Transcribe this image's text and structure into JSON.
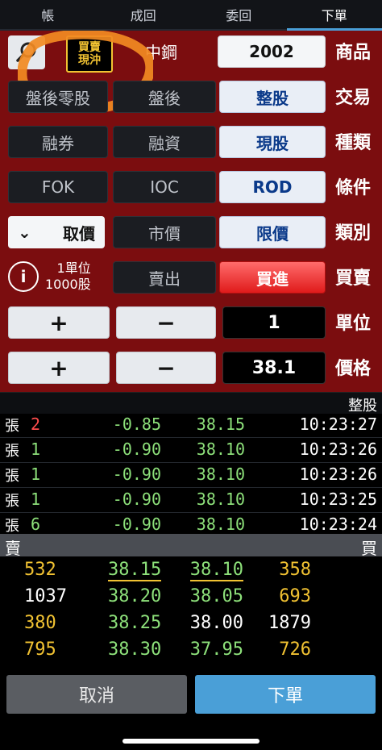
{
  "tabs": [
    {
      "label": "下單",
      "active": true
    },
    {
      "label": "委回"
    },
    {
      "label": "成回"
    },
    {
      "label": "帳"
    }
  ],
  "order": {
    "product_label": "商品",
    "stock_code": "2002",
    "stock_name": "中鋼",
    "quick_badge_top": "買賣",
    "quick_badge_bottom": "現沖",
    "trade_label": "交易",
    "trade_options": [
      "整股",
      "盤後",
      "盤後零股"
    ],
    "type_label": "種類",
    "type_options": [
      "現股",
      "融資",
      "融券"
    ],
    "cond_label": "條件",
    "cond_options": [
      "ROD",
      "IOC",
      "FOK"
    ],
    "category_label": "類別",
    "category_options": [
      "限價",
      "市價"
    ],
    "price_source": "取價",
    "side_label": "買賣",
    "side_options": [
      "買進",
      "賣出"
    ],
    "unit_info_top": "1單位",
    "unit_info_bottom": "1000股",
    "unit_label": "單位",
    "unit_value": "1",
    "price_label": "價格",
    "price_value": "38.1",
    "minus": "−",
    "plus": "+"
  },
  "trades": {
    "title": "整股",
    "unit": "張",
    "rows": [
      {
        "time": "10:23:27",
        "price": "38.15",
        "change": "-0.85",
        "vol": "2",
        "red": true
      },
      {
        "time": "10:23:26",
        "price": "38.10",
        "change": "-0.90",
        "vol": "1"
      },
      {
        "time": "10:23:26",
        "price": "38.10",
        "change": "-0.90",
        "vol": "1"
      },
      {
        "time": "10:23:25",
        "price": "38.10",
        "change": "-0.90",
        "vol": "1"
      },
      {
        "time": "10:23:24",
        "price": "38.10",
        "change": "-0.90",
        "vol": "6"
      }
    ]
  },
  "book": {
    "buy_label": "買",
    "sell_label": "賣",
    "rows": [
      {
        "buy_vol": "358",
        "buy_price": "38.10",
        "sell_price": "38.15",
        "sell_vol": "532"
      },
      {
        "buy_vol": "693",
        "buy_price": "38.05",
        "sell_price": "38.20",
        "sell_vol": "1037"
      },
      {
        "buy_vol": "1879",
        "buy_price": "38.00",
        "sell_price": "38.25",
        "sell_vol": "380"
      },
      {
        "buy_vol": "726",
        "buy_price": "37.95",
        "sell_price": "38.30",
        "sell_vol": "795"
      }
    ]
  },
  "buttons": {
    "cancel": "取消",
    "submit": "下單"
  },
  "colors": {
    "panel": "#7b0d0f",
    "accent_blue": "#4a9fd7",
    "price_green": "#8de07a",
    "volume_yellow": "#f1c232",
    "up_red": "#ff4d4d"
  }
}
